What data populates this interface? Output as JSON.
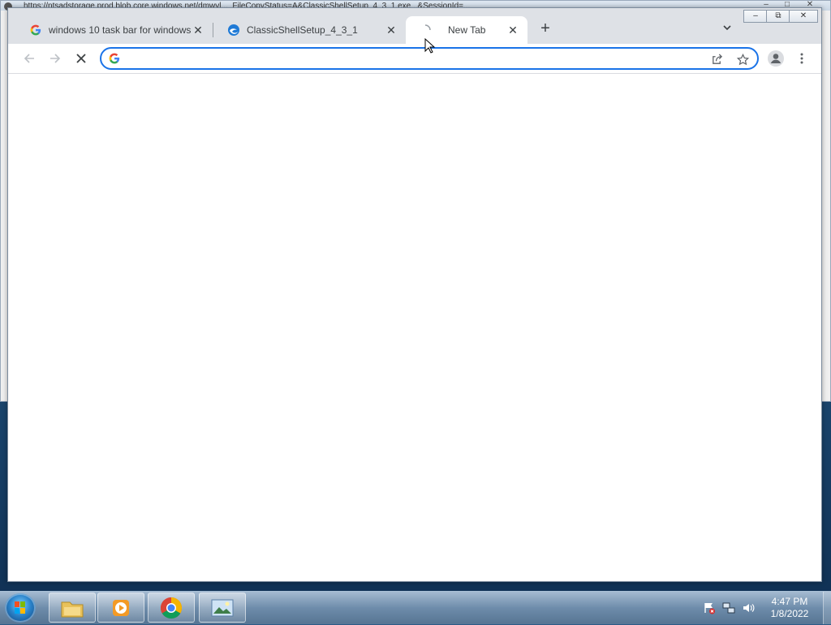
{
  "background_window": {
    "title": "https://ntsadstorage.prod.blob.core.windows.net/dmwvl..._FileCopyStatus=A&ClassicShellSetup_4_3_1.exe...&SessionId=...",
    "minimize": "–",
    "maximize": "□",
    "close": "✕"
  },
  "browser": {
    "tabs": [
      {
        "label": "windows 10 task bar for windows",
        "favicon": "google-icon",
        "active": false
      },
      {
        "label": "ClassicShellSetup_4_3_1",
        "favicon": "edge-download-icon",
        "active": false
      },
      {
        "label": "New Tab",
        "favicon": "loading-icon",
        "active": true
      }
    ],
    "tab_close_glyph": "✕",
    "new_tab_glyph": "+",
    "tab_search_glyph": "⌄",
    "window_controls": {
      "minimize": "–",
      "maximize": "⧉",
      "close": "✕"
    },
    "toolbar": {
      "back": "←",
      "forward": "→",
      "stop": "✕"
    },
    "omnibox": {
      "value": "",
      "placeholder": ""
    },
    "icons": {
      "share": "share-icon",
      "bookmark": "star-icon",
      "profile": "profile-icon",
      "menu": "kebab-menu-icon"
    }
  },
  "taskbar": {
    "apps": [
      {
        "name": "file-explorer",
        "icon": "folder-icon"
      },
      {
        "name": "media-player",
        "icon": "media-player-icon"
      },
      {
        "name": "chrome",
        "icon": "chrome-icon"
      },
      {
        "name": "image-viewer",
        "icon": "picture-icon"
      }
    ],
    "clock": {
      "time": "4:47 PM",
      "date": "1/8/2022"
    }
  },
  "colors": {
    "accent": "#1a73e8",
    "tabstrip": "#dee1e6",
    "desktop": "#1d4a73"
  }
}
